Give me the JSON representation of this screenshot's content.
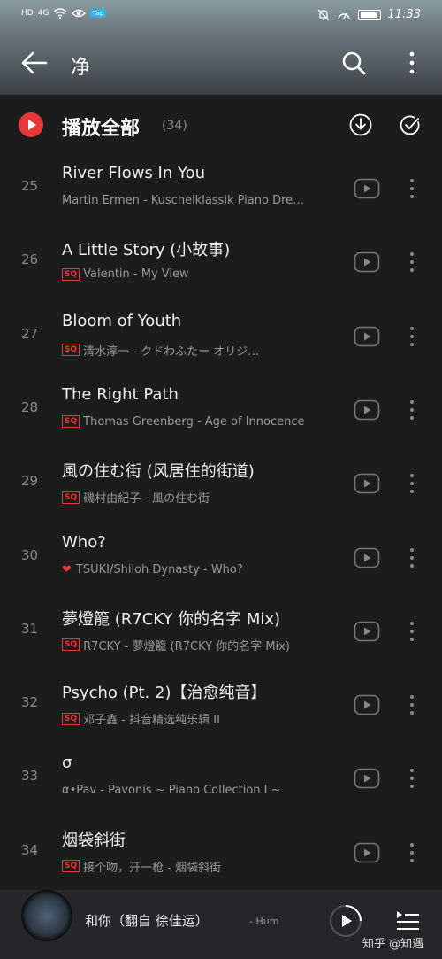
{
  "status_bar": {
    "left_items": [
      "HD",
      "4G",
      "WiFi"
    ],
    "tap_badge": "Tap",
    "time": "11:33"
  },
  "nav": {
    "title": "净"
  },
  "play_all": {
    "label": "播放全部",
    "count": "(34)"
  },
  "tracks": [
    {
      "num": "25",
      "title": "River Flows In You",
      "subtitle": "Martin Ermen - Kuschelklassik Piano Dre…",
      "badge": ""
    },
    {
      "num": "26",
      "title": "A Little Story (小故事)",
      "subtitle": "Valentin - My View",
      "badge": "SQ"
    },
    {
      "num": "27",
      "title": "Bloom of Youth",
      "subtitle": "清水淳一 - クドわふたー オリジ…",
      "badge": "SQ"
    },
    {
      "num": "28",
      "title": "The Right Path",
      "subtitle": "Thomas Greenberg - Age of Innocence",
      "badge": "SQ"
    },
    {
      "num": "29",
      "title": "風の住む街 (风居住的街道)",
      "subtitle": "磯村由紀子 - 風の住む街",
      "badge": "SQ"
    },
    {
      "num": "30",
      "title": "Who?",
      "subtitle": "TSUKI/Shiloh Dynasty - Who?",
      "badge": "heart"
    },
    {
      "num": "31",
      "title": "夢燈籠 (R7CKY 你的名字 Mix)",
      "subtitle": "R7CKY - 夢燈籠 (R7CKY 你的名字 Mix)",
      "badge": "SQ"
    },
    {
      "num": "32",
      "title": "Psycho (Pt. 2)【治愈纯音】",
      "subtitle": "邓子鑫 - 抖音精选纯乐辑 II",
      "badge": "SQ"
    },
    {
      "num": "33",
      "title": "σ",
      "subtitle": "α•Pav - Pavonis ~ Piano Collection Ⅰ ~",
      "badge": ""
    },
    {
      "num": "34",
      "title": "烟袋斜街",
      "subtitle": "接个吻，开一枪 - 烟袋斜街",
      "badge": "SQ"
    }
  ],
  "player": {
    "song": "和你（翻自 徐佳运）",
    "artist": "- Hum"
  },
  "watermark": "知乎 @知遇",
  "colors": {
    "accent": "#e73939",
    "background": "#1c1c1d"
  }
}
